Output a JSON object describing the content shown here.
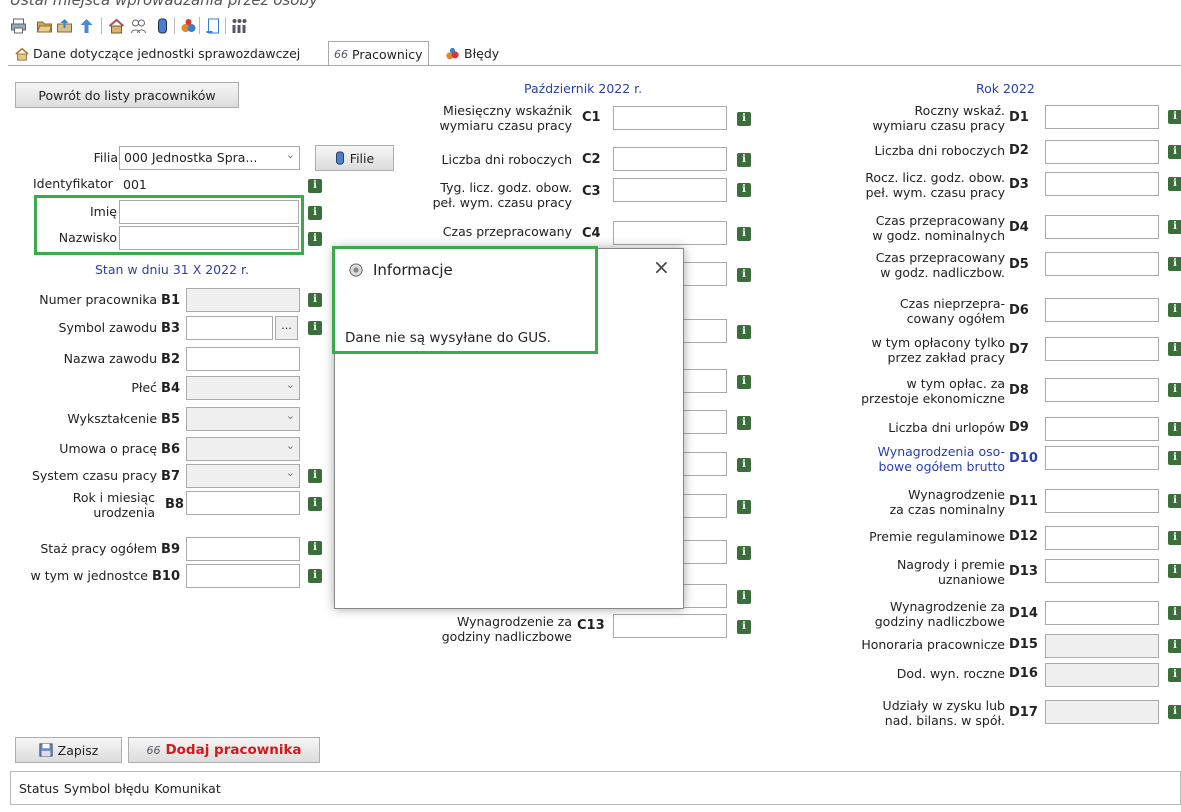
{
  "caption": "Ustal miejsca wprowadzania przez osoby",
  "toolbar": [
    "print-icon",
    "open-icon",
    "upload-icon",
    "up-arrow-icon",
    "house-icon",
    "workers-icon",
    "database-icon",
    "people-icon",
    "save-doc-icon",
    "table-icon"
  ],
  "tabs": [
    {
      "label": "Dane dotyczące jednostki sprawozdawczej"
    },
    {
      "label": "Pracownicy"
    },
    {
      "label": "Błędy"
    }
  ],
  "buttons": {
    "back": "Powrót do listy pracowników",
    "filie": "Filie",
    "save": "Zapisz",
    "add": "Dodaj pracownika"
  },
  "left": {
    "filia_label": "Filia",
    "filia_value": "000 Jednostka Spra...",
    "id_label": "Identyfikator",
    "id_value": "001",
    "imie_label": "Imię",
    "nazwisko_label": "Nazwisko",
    "state_header": "Stan w dniu 31 X 2022 r.",
    "fields": [
      {
        "label": "Numer pracownika",
        "code": "B1"
      },
      {
        "label": "Symbol zawodu",
        "code": "B3"
      },
      {
        "label": "Nazwa zawodu",
        "code": "B2"
      },
      {
        "label": "Płeć",
        "code": "B4"
      },
      {
        "label": "Wykształcenie",
        "code": "B5"
      },
      {
        "label": "Umowa o pracę",
        "code": "B6"
      },
      {
        "label": "System czasu pracy",
        "code": "B7"
      },
      {
        "label": "Rok i miesiąc",
        "label2": "urodzenia",
        "code": "B8"
      },
      {
        "label": "Staż pracy ogółem",
        "code": "B9"
      },
      {
        "label": "w tym w jednostce",
        "code": "B10"
      }
    ]
  },
  "middle": {
    "header": "Październik 2022 r.",
    "fields": [
      {
        "label": "Miesięczny wskaźnik",
        "label2": "wymiaru czasu pracy",
        "code": "C1"
      },
      {
        "label": "Liczba dni roboczych",
        "code": "C2"
      },
      {
        "label": "Tyg. licz. godz. obow.",
        "label2": "peł. wym. czasu pracy",
        "code": "C3"
      },
      {
        "label": "Czas przepracowany",
        "code": "C4"
      },
      {
        "label": "Wynagrodzenie za",
        "label2": "godziny nadliczbowe",
        "code": "C13"
      }
    ]
  },
  "right": {
    "header": "Rok 2022",
    "fields": [
      {
        "label": "Roczny wskaź.",
        "label2": "wymiaru czasu pracy",
        "code": "D1"
      },
      {
        "label": "Liczba dni roboczych",
        "code": "D2"
      },
      {
        "label": "Rocz. licz. godz. obow.",
        "label2": "peł. wym. czasu pracy",
        "code": "D3"
      },
      {
        "label": "Czas przepracowany",
        "label2": "w godz. nominalnych",
        "code": "D4"
      },
      {
        "label": "Czas przepracowany",
        "label2": "w godz. nadliczbow.",
        "code": "D5"
      },
      {
        "label": "Czas nieprzepra-",
        "label2": "cowany ogółem",
        "code": "D6"
      },
      {
        "label": "w tym opłacony tylko",
        "label2": "przez zakład pracy",
        "code": "D7"
      },
      {
        "label": "w tym opłac. za",
        "label2": "przestoje ekonomiczne",
        "code": "D8"
      },
      {
        "label": "Liczba dni urlopów",
        "code": "D9"
      },
      {
        "label": "Wynagrodzenia oso-",
        "label2": "bowe ogółem brutto",
        "code": "D10"
      },
      {
        "label": "Wynagrodzenie",
        "label2": "za czas nominalny",
        "code": "D11"
      },
      {
        "label": "Premie regulaminowe",
        "code": "D12"
      },
      {
        "label": "Nagrody i premie",
        "label2": "uznaniowe",
        "code": "D13"
      },
      {
        "label": "Wynagrodzenie za",
        "label2": "godziny nadliczbowe",
        "code": "D14"
      },
      {
        "label": "Honoraria pracownicze",
        "code": "D15"
      },
      {
        "label": "Dod. wyn. roczne",
        "code": "D16"
      },
      {
        "label": "Udziały w zysku lub",
        "label2": "nad. bilans. w spół.",
        "code": "D17"
      }
    ]
  },
  "dialog": {
    "title": "Informacje",
    "message": "Dane nie są wysyłane do GUS."
  },
  "status": {
    "c1": "Status",
    "c2": "Symbol błędu",
    "c3": "Komunikat"
  },
  "colors": {
    "highlight": "#3aaa4a",
    "header_blue": "#2a3fa8",
    "add_red": "#d11a1a",
    "info_green": "#3a6e3a"
  }
}
